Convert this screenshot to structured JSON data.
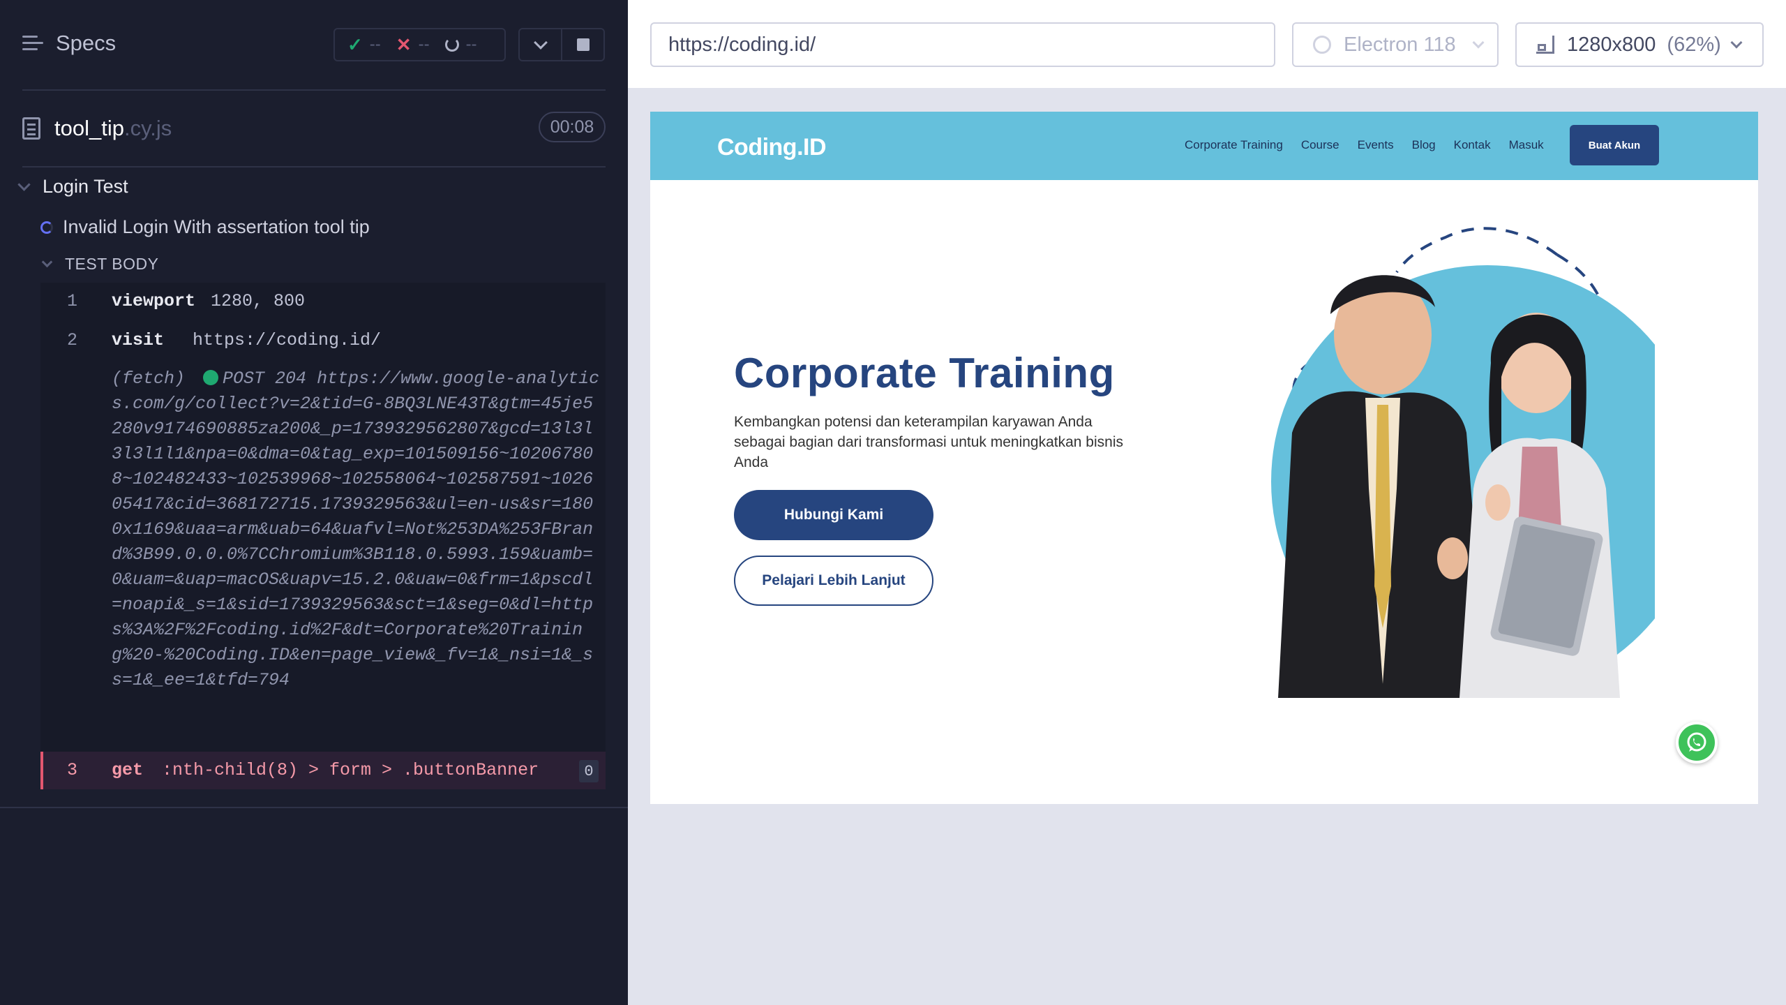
{
  "reporter": {
    "specs_label": "Specs",
    "stats": {
      "passed": "--",
      "failed": "--",
      "pending": "--"
    },
    "spec": {
      "name": "tool_tip",
      "ext": ".cy.js",
      "duration": "00:08"
    },
    "suite_title": "Login Test",
    "test_title": "Invalid Login With assertation tool tip",
    "test_body_label": "TEST BODY",
    "commands": [
      {
        "num": "1",
        "name": "viewport",
        "arg": "1280, 800"
      },
      {
        "num": "2",
        "name": "visit",
        "arg": "https://coding.id/"
      },
      {
        "num": "3",
        "name": "get",
        "arg": ":nth-child(8) > form > .buttonBanner",
        "count": "0"
      }
    ],
    "fetch": {
      "label": "(fetch)",
      "method_status": "POST 204",
      "url": "https://www.google-analytics.com/g/collect?v=2&tid=G-8BQ3LNE43T&gtm=45je5280v9174690885za200&_p=1739329562807&gcd=13l3l3l3l1l1&npa=0&dma=0&tag_exp=101509156~102067808~102482433~102539968~102558064~102587591~102605417&cid=368172715.1739329563&ul=en-us&sr=1800x1169&uaa=arm&uab=64&uafvl=Not%253DA%253FBrand%3B99.0.0.0%7CChromium%3B118.0.5993.159&uamb=0&uam=&uap=macOS&uapv=15.2.0&uaw=0&frm=1&pscdl=noapi&_s=1&sid=1739329563&sct=1&seg=0&dl=https%3A%2F%2Fcoding.id%2F&dt=Corporate%20Training%20-%20Coding.ID&en=page_view&_fv=1&_nsi=1&_ss=1&_ee=1&tfd=794"
    }
  },
  "aut_bar": {
    "url": "https://coding.id/",
    "browser": "Electron 118",
    "viewport_size": "1280x800",
    "viewport_scale": "(62%)"
  },
  "site": {
    "logo": "Coding.ID",
    "menu": [
      "Corporate Training",
      "Course",
      "Events",
      "Blog",
      "Kontak",
      "Masuk"
    ],
    "signup": "Buat Akun",
    "hero_title": "Corporate Training",
    "hero_desc": "Kembangkan potensi dan keterampilan karyawan Anda sebagai bagian dari transformasi untuk meningkatkan bisnis Anda",
    "btn_primary": "Hubungi Kami",
    "btn_secondary": "Pelajari Lebih Lanjut"
  },
  "colors": {
    "reporter_bg": "#1b1e2e",
    "site_nav": "#65c0dc",
    "brand_blue": "#26457f",
    "fail": "#e45770",
    "pass": "#1fa971"
  },
  "icons": [
    "specs-icon",
    "check-icon",
    "x-icon",
    "spinner-icon",
    "chevron-down-icon",
    "stop-icon",
    "file-icon",
    "electron-icon",
    "viewport-icon",
    "whatsapp-icon"
  ]
}
